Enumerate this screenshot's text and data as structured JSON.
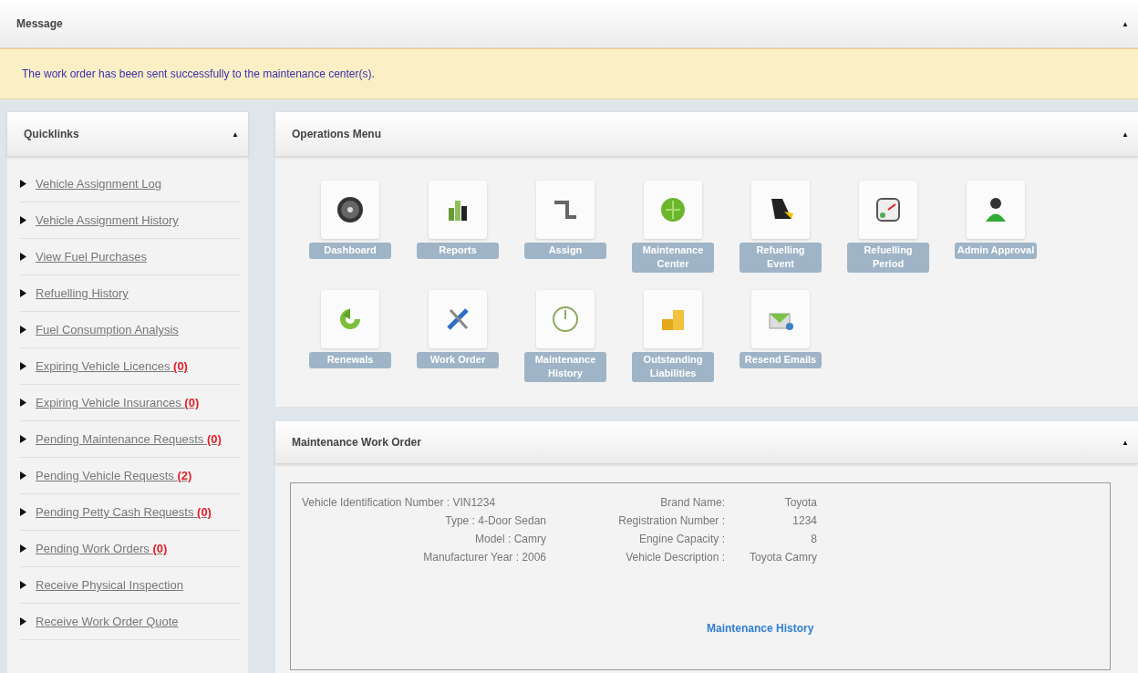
{
  "message_panel": {
    "title": "Message",
    "collapse": "▲",
    "text": "The work order has been sent successfully to the maintenance center(s)."
  },
  "quicklinks": {
    "title": "Quicklinks",
    "collapse": "▲",
    "items": [
      {
        "label": "Vehicle Assignment Log"
      },
      {
        "label": "Vehicle Assignment History"
      },
      {
        "label": "View Fuel Purchases"
      },
      {
        "label": "Refuelling History"
      },
      {
        "label": "Fuel Consumption Analysis"
      },
      {
        "label": "Expiring Vehicle Licences",
        "count": "(0)"
      },
      {
        "label": "Expiring Vehicle Insurances",
        "count": "(0)"
      },
      {
        "label": "Pending Maintenance Requests",
        "count": "(0)"
      },
      {
        "label": "Pending Vehicle Requests",
        "count": "(2)"
      },
      {
        "label": "Pending Petty Cash Requests",
        "count": "(0)"
      },
      {
        "label": "Pending Work Orders",
        "count": "(0)"
      },
      {
        "label": "Receive Physical Inspection"
      },
      {
        "label": "Receive Work Order Quote"
      }
    ]
  },
  "operations_menu": {
    "title": "Operations Menu",
    "collapse": "▲",
    "tiles": [
      {
        "label": "Dashboard"
      },
      {
        "label": "Reports"
      },
      {
        "label": "Assign"
      },
      {
        "label": "Maintenance Center"
      },
      {
        "label": "Refuelling Event"
      },
      {
        "label": "Refuelling Period"
      },
      {
        "label": "Admin Approval"
      },
      {
        "label": "Renewals"
      },
      {
        "label": "Work Order"
      },
      {
        "label": "Maintenance History"
      },
      {
        "label": "Outstanding Liabilities"
      },
      {
        "label": "Resend Emails"
      }
    ]
  },
  "work_order": {
    "title": "Maintenance Work Order",
    "collapse": "▲",
    "rows": [
      {
        "left": "Vehicle Identification Number : VIN1234",
        "right_label": "Brand Name:",
        "right_value": "Toyota"
      },
      {
        "left": "Type : 4-Door Sedan",
        "right_label": "Registration Number :",
        "right_value": "1234"
      },
      {
        "left": "Model : Camry",
        "right_label": "Engine Capacity :",
        "right_value": "8"
      },
      {
        "left": "Manufacturer Year : 2006",
        "right_label": "Vehicle Description :",
        "right_value": "Toyota Camry"
      }
    ],
    "link": "Maintenance History"
  }
}
